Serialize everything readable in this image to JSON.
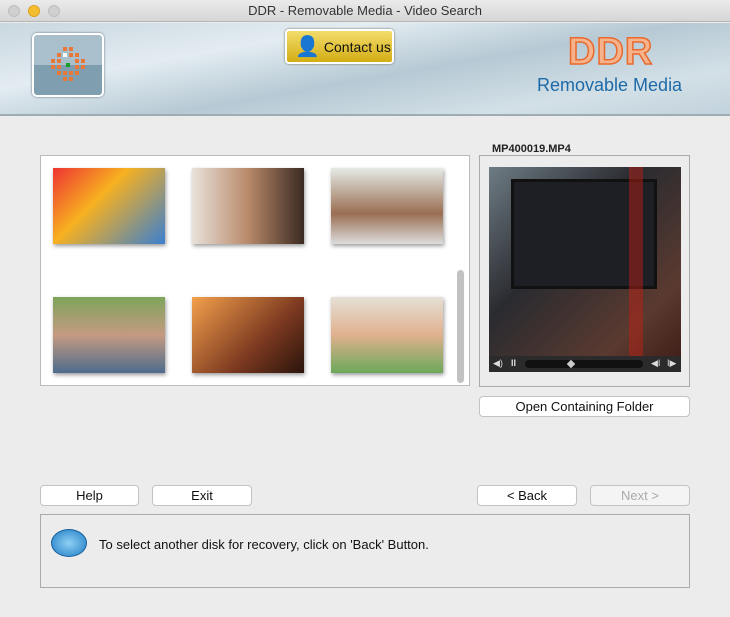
{
  "window": {
    "title": "DDR - Removable Media - Video Search"
  },
  "banner": {
    "contact_label": "Contact us",
    "brand": "DDR",
    "product": "Removable Media"
  },
  "gallery": {
    "thumbnails": [
      "photo-1",
      "photo-2",
      "photo-3",
      "photo-4",
      "photo-5",
      "photo-6"
    ]
  },
  "preview": {
    "filename": "MP400019.MP4",
    "playback_progress": 0.38,
    "open_folder_label": "Open Containing Folder"
  },
  "buttons": {
    "help": "Help",
    "exit": "Exit",
    "back": "< Back",
    "next": "Next >"
  },
  "message": {
    "text": "To select another disk for recovery, click on 'Back' Button."
  }
}
